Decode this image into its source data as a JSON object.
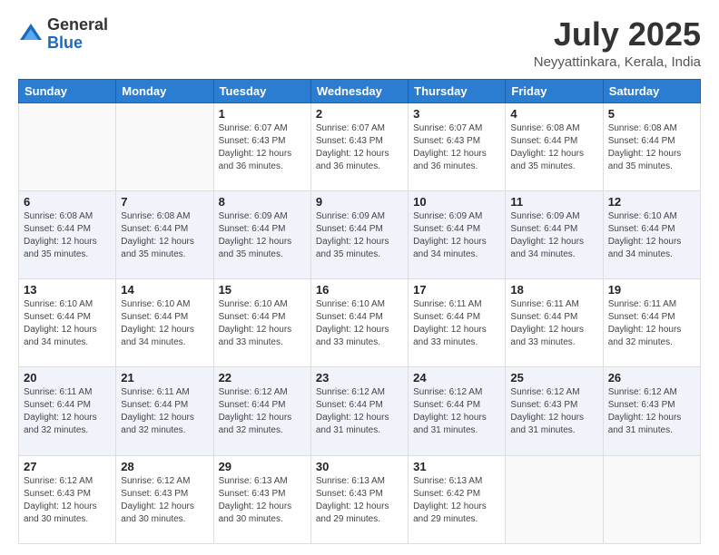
{
  "header": {
    "logo_general": "General",
    "logo_blue": "Blue",
    "month_title": "July 2025",
    "location": "Neyyattinkara, Kerala, India"
  },
  "calendar": {
    "days_of_week": [
      "Sunday",
      "Monday",
      "Tuesday",
      "Wednesday",
      "Thursday",
      "Friday",
      "Saturday"
    ],
    "weeks": [
      [
        {
          "day": "",
          "detail": ""
        },
        {
          "day": "",
          "detail": ""
        },
        {
          "day": "1",
          "detail": "Sunrise: 6:07 AM\nSunset: 6:43 PM\nDaylight: 12 hours\nand 36 minutes."
        },
        {
          "day": "2",
          "detail": "Sunrise: 6:07 AM\nSunset: 6:43 PM\nDaylight: 12 hours\nand 36 minutes."
        },
        {
          "day": "3",
          "detail": "Sunrise: 6:07 AM\nSunset: 6:43 PM\nDaylight: 12 hours\nand 36 minutes."
        },
        {
          "day": "4",
          "detail": "Sunrise: 6:08 AM\nSunset: 6:44 PM\nDaylight: 12 hours\nand 35 minutes."
        },
        {
          "day": "5",
          "detail": "Sunrise: 6:08 AM\nSunset: 6:44 PM\nDaylight: 12 hours\nand 35 minutes."
        }
      ],
      [
        {
          "day": "6",
          "detail": "Sunrise: 6:08 AM\nSunset: 6:44 PM\nDaylight: 12 hours\nand 35 minutes."
        },
        {
          "day": "7",
          "detail": "Sunrise: 6:08 AM\nSunset: 6:44 PM\nDaylight: 12 hours\nand 35 minutes."
        },
        {
          "day": "8",
          "detail": "Sunrise: 6:09 AM\nSunset: 6:44 PM\nDaylight: 12 hours\nand 35 minutes."
        },
        {
          "day": "9",
          "detail": "Sunrise: 6:09 AM\nSunset: 6:44 PM\nDaylight: 12 hours\nand 35 minutes."
        },
        {
          "day": "10",
          "detail": "Sunrise: 6:09 AM\nSunset: 6:44 PM\nDaylight: 12 hours\nand 34 minutes."
        },
        {
          "day": "11",
          "detail": "Sunrise: 6:09 AM\nSunset: 6:44 PM\nDaylight: 12 hours\nand 34 minutes."
        },
        {
          "day": "12",
          "detail": "Sunrise: 6:10 AM\nSunset: 6:44 PM\nDaylight: 12 hours\nand 34 minutes."
        }
      ],
      [
        {
          "day": "13",
          "detail": "Sunrise: 6:10 AM\nSunset: 6:44 PM\nDaylight: 12 hours\nand 34 minutes."
        },
        {
          "day": "14",
          "detail": "Sunrise: 6:10 AM\nSunset: 6:44 PM\nDaylight: 12 hours\nand 34 minutes."
        },
        {
          "day": "15",
          "detail": "Sunrise: 6:10 AM\nSunset: 6:44 PM\nDaylight: 12 hours\nand 33 minutes."
        },
        {
          "day": "16",
          "detail": "Sunrise: 6:10 AM\nSunset: 6:44 PM\nDaylight: 12 hours\nand 33 minutes."
        },
        {
          "day": "17",
          "detail": "Sunrise: 6:11 AM\nSunset: 6:44 PM\nDaylight: 12 hours\nand 33 minutes."
        },
        {
          "day": "18",
          "detail": "Sunrise: 6:11 AM\nSunset: 6:44 PM\nDaylight: 12 hours\nand 33 minutes."
        },
        {
          "day": "19",
          "detail": "Sunrise: 6:11 AM\nSunset: 6:44 PM\nDaylight: 12 hours\nand 32 minutes."
        }
      ],
      [
        {
          "day": "20",
          "detail": "Sunrise: 6:11 AM\nSunset: 6:44 PM\nDaylight: 12 hours\nand 32 minutes."
        },
        {
          "day": "21",
          "detail": "Sunrise: 6:11 AM\nSunset: 6:44 PM\nDaylight: 12 hours\nand 32 minutes."
        },
        {
          "day": "22",
          "detail": "Sunrise: 6:12 AM\nSunset: 6:44 PM\nDaylight: 12 hours\nand 32 minutes."
        },
        {
          "day": "23",
          "detail": "Sunrise: 6:12 AM\nSunset: 6:44 PM\nDaylight: 12 hours\nand 31 minutes."
        },
        {
          "day": "24",
          "detail": "Sunrise: 6:12 AM\nSunset: 6:44 PM\nDaylight: 12 hours\nand 31 minutes."
        },
        {
          "day": "25",
          "detail": "Sunrise: 6:12 AM\nSunset: 6:43 PM\nDaylight: 12 hours\nand 31 minutes."
        },
        {
          "day": "26",
          "detail": "Sunrise: 6:12 AM\nSunset: 6:43 PM\nDaylight: 12 hours\nand 31 minutes."
        }
      ],
      [
        {
          "day": "27",
          "detail": "Sunrise: 6:12 AM\nSunset: 6:43 PM\nDaylight: 12 hours\nand 30 minutes."
        },
        {
          "day": "28",
          "detail": "Sunrise: 6:12 AM\nSunset: 6:43 PM\nDaylight: 12 hours\nand 30 minutes."
        },
        {
          "day": "29",
          "detail": "Sunrise: 6:13 AM\nSunset: 6:43 PM\nDaylight: 12 hours\nand 30 minutes."
        },
        {
          "day": "30",
          "detail": "Sunrise: 6:13 AM\nSunset: 6:43 PM\nDaylight: 12 hours\nand 29 minutes."
        },
        {
          "day": "31",
          "detail": "Sunrise: 6:13 AM\nSunset: 6:42 PM\nDaylight: 12 hours\nand 29 minutes."
        },
        {
          "day": "",
          "detail": ""
        },
        {
          "day": "",
          "detail": ""
        }
      ]
    ]
  }
}
